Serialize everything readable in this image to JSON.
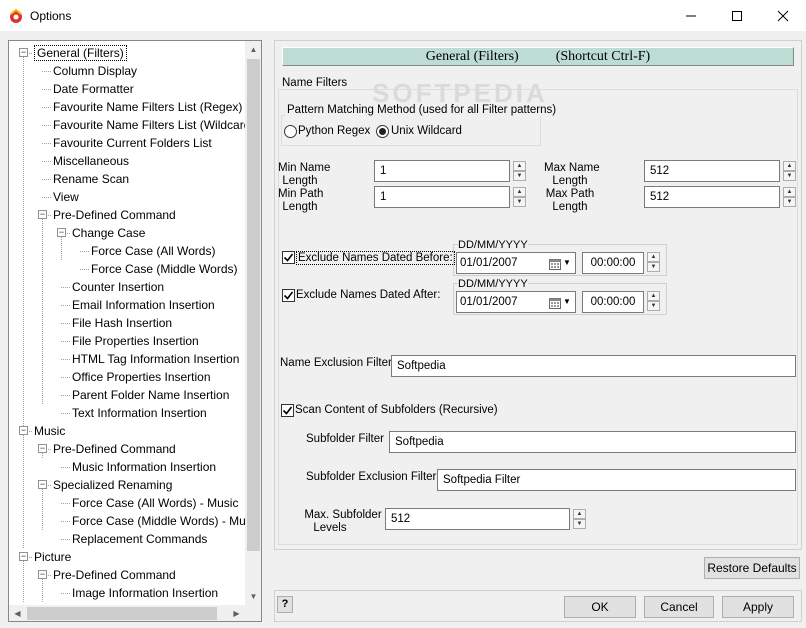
{
  "window": {
    "title": "Options"
  },
  "tree": {
    "items": [
      {
        "label": "General  (Filters)"
      },
      {
        "label": "Column Display"
      },
      {
        "label": "Date Formatter"
      },
      {
        "label": "Favourite Name Filters List (Regex)"
      },
      {
        "label": "Favourite Name Filters List (Wildcard)"
      },
      {
        "label": "Favourite Current Folders List"
      },
      {
        "label": "Miscellaneous"
      },
      {
        "label": "Rename Scan"
      },
      {
        "label": "View"
      },
      {
        "label": "Pre-Defined Command"
      },
      {
        "label": "Change Case"
      },
      {
        "label": "Force Case (All Words)"
      },
      {
        "label": "Force Case (Middle Words)"
      },
      {
        "label": "Counter Insertion"
      },
      {
        "label": "Email Information Insertion"
      },
      {
        "label": "File Hash Insertion"
      },
      {
        "label": "File Properties Insertion"
      },
      {
        "label": "HTML Tag Information Insertion"
      },
      {
        "label": "Office Properties Insertion"
      },
      {
        "label": "Parent Folder Name Insertion"
      },
      {
        "label": "Text Information Insertion"
      },
      {
        "label": "Music"
      },
      {
        "label": "Pre-Defined Command"
      },
      {
        "label": "Music Information Insertion"
      },
      {
        "label": "Specialized Renaming"
      },
      {
        "label": "Force Case (All Words) - Music"
      },
      {
        "label": "Force Case (Middle Words) - Music"
      },
      {
        "label": "Replacement Commands"
      },
      {
        "label": "Picture"
      },
      {
        "label": "Pre-Defined Command"
      },
      {
        "label": "Image Information Insertion"
      }
    ]
  },
  "header": {
    "title": "General  (Filters)",
    "shortcut": "(Shortcut Ctrl-F)"
  },
  "watermark": "SOFTPEDIA",
  "name_filters": {
    "group_label": "Name Filters",
    "pattern_group_label": "Pattern Matching Method (used for all Filter patterns)",
    "radio_regex": "Python Regex",
    "radio_wildcard": "Unix Wildcard",
    "selected_method": "Unix Wildcard",
    "min_name_label_1": "Min Name",
    "min_name_label_2": "Length",
    "min_name_value": "1",
    "min_path_label_1": "Min Path",
    "min_path_label_2": "Length",
    "min_path_value": "1",
    "max_name_label_1": "Max Name",
    "max_name_label_2": "Length",
    "max_name_value": "512",
    "max_path_label_1": "Max Path",
    "max_path_label_2": "Length",
    "max_path_value": "512",
    "exclude_before_label": "Exclude Names Dated Before:",
    "exclude_before_checked": true,
    "exclude_after_label": "Exclude Names Dated After:",
    "exclude_after_checked": true,
    "date_format": "DD/MM/YYYY",
    "before_date": "01/01/2007",
    "before_time": "00:00:00",
    "after_date": "01/01/2007",
    "after_time": "00:00:00",
    "name_exclusion_label": "Name Exclusion Filter",
    "name_exclusion_value": "Softpedia",
    "scan_subfolders_label": "Scan Content of Subfolders (Recursive)",
    "scan_subfolders_checked": true,
    "subfolder_filter_label": "Subfolder Filter",
    "subfolder_filter_value": "Softpedia",
    "subfolder_exclusion_label": "Subfolder Exclusion Filter",
    "subfolder_exclusion_value": "Softpedia Filter",
    "max_subfolder_label_1": "Max. Subfolder",
    "max_subfolder_label_2": "Levels",
    "max_subfolder_value": "512"
  },
  "buttons": {
    "restore_defaults": "Restore Defaults",
    "help": "?",
    "ok": "OK",
    "cancel": "Cancel",
    "apply": "Apply"
  }
}
